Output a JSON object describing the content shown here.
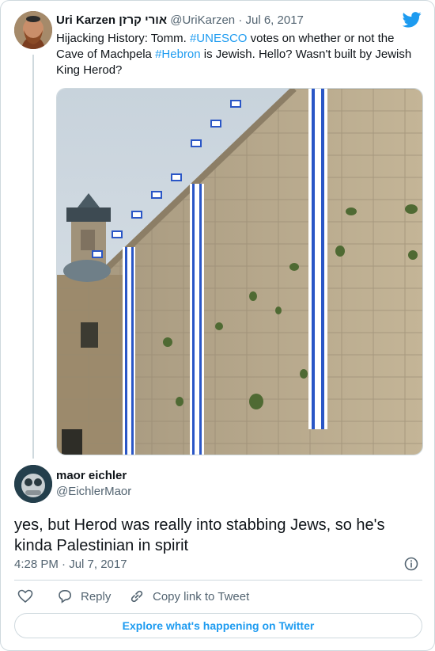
{
  "tweet_original": {
    "author_name": "Uri Karzen אורי קרזן",
    "handle": "@UriKarzen",
    "separator": " · ",
    "date": "Jul 6, 2017",
    "text_before_tag1": "Hijacking History: Tomm. ",
    "hashtag1": "#UNESCO",
    "text_between_tags": " votes on whether or not the Cave of Machpela ",
    "hashtag2": "#Hebron",
    "text_after_tag2": " is Jewish. Hello?  Wasn't built by Jewish King Herod?"
  },
  "reply": {
    "author_name": "maor eichler",
    "handle": "@EichlerMaor",
    "text": "yes, but Herod was really into stabbing Jews, so he's kinda Palestinian in spirit",
    "timestamp": "4:28 PM · Jul 7, 2017"
  },
  "actions": {
    "reply_label": "Reply",
    "copy_link_label": "Copy link to Tweet"
  },
  "footer": {
    "explore_label": "Explore what's happening on Twitter"
  },
  "icons": {
    "brand": "twitter-bird-icon",
    "info": "info-icon",
    "like": "heart-icon",
    "reply": "reply-bubble-icon",
    "copy": "link-icon"
  },
  "colors": {
    "accent": "#1d9bf0",
    "text": "#0f1419",
    "muted": "#536471",
    "border": "#cfd9de"
  }
}
